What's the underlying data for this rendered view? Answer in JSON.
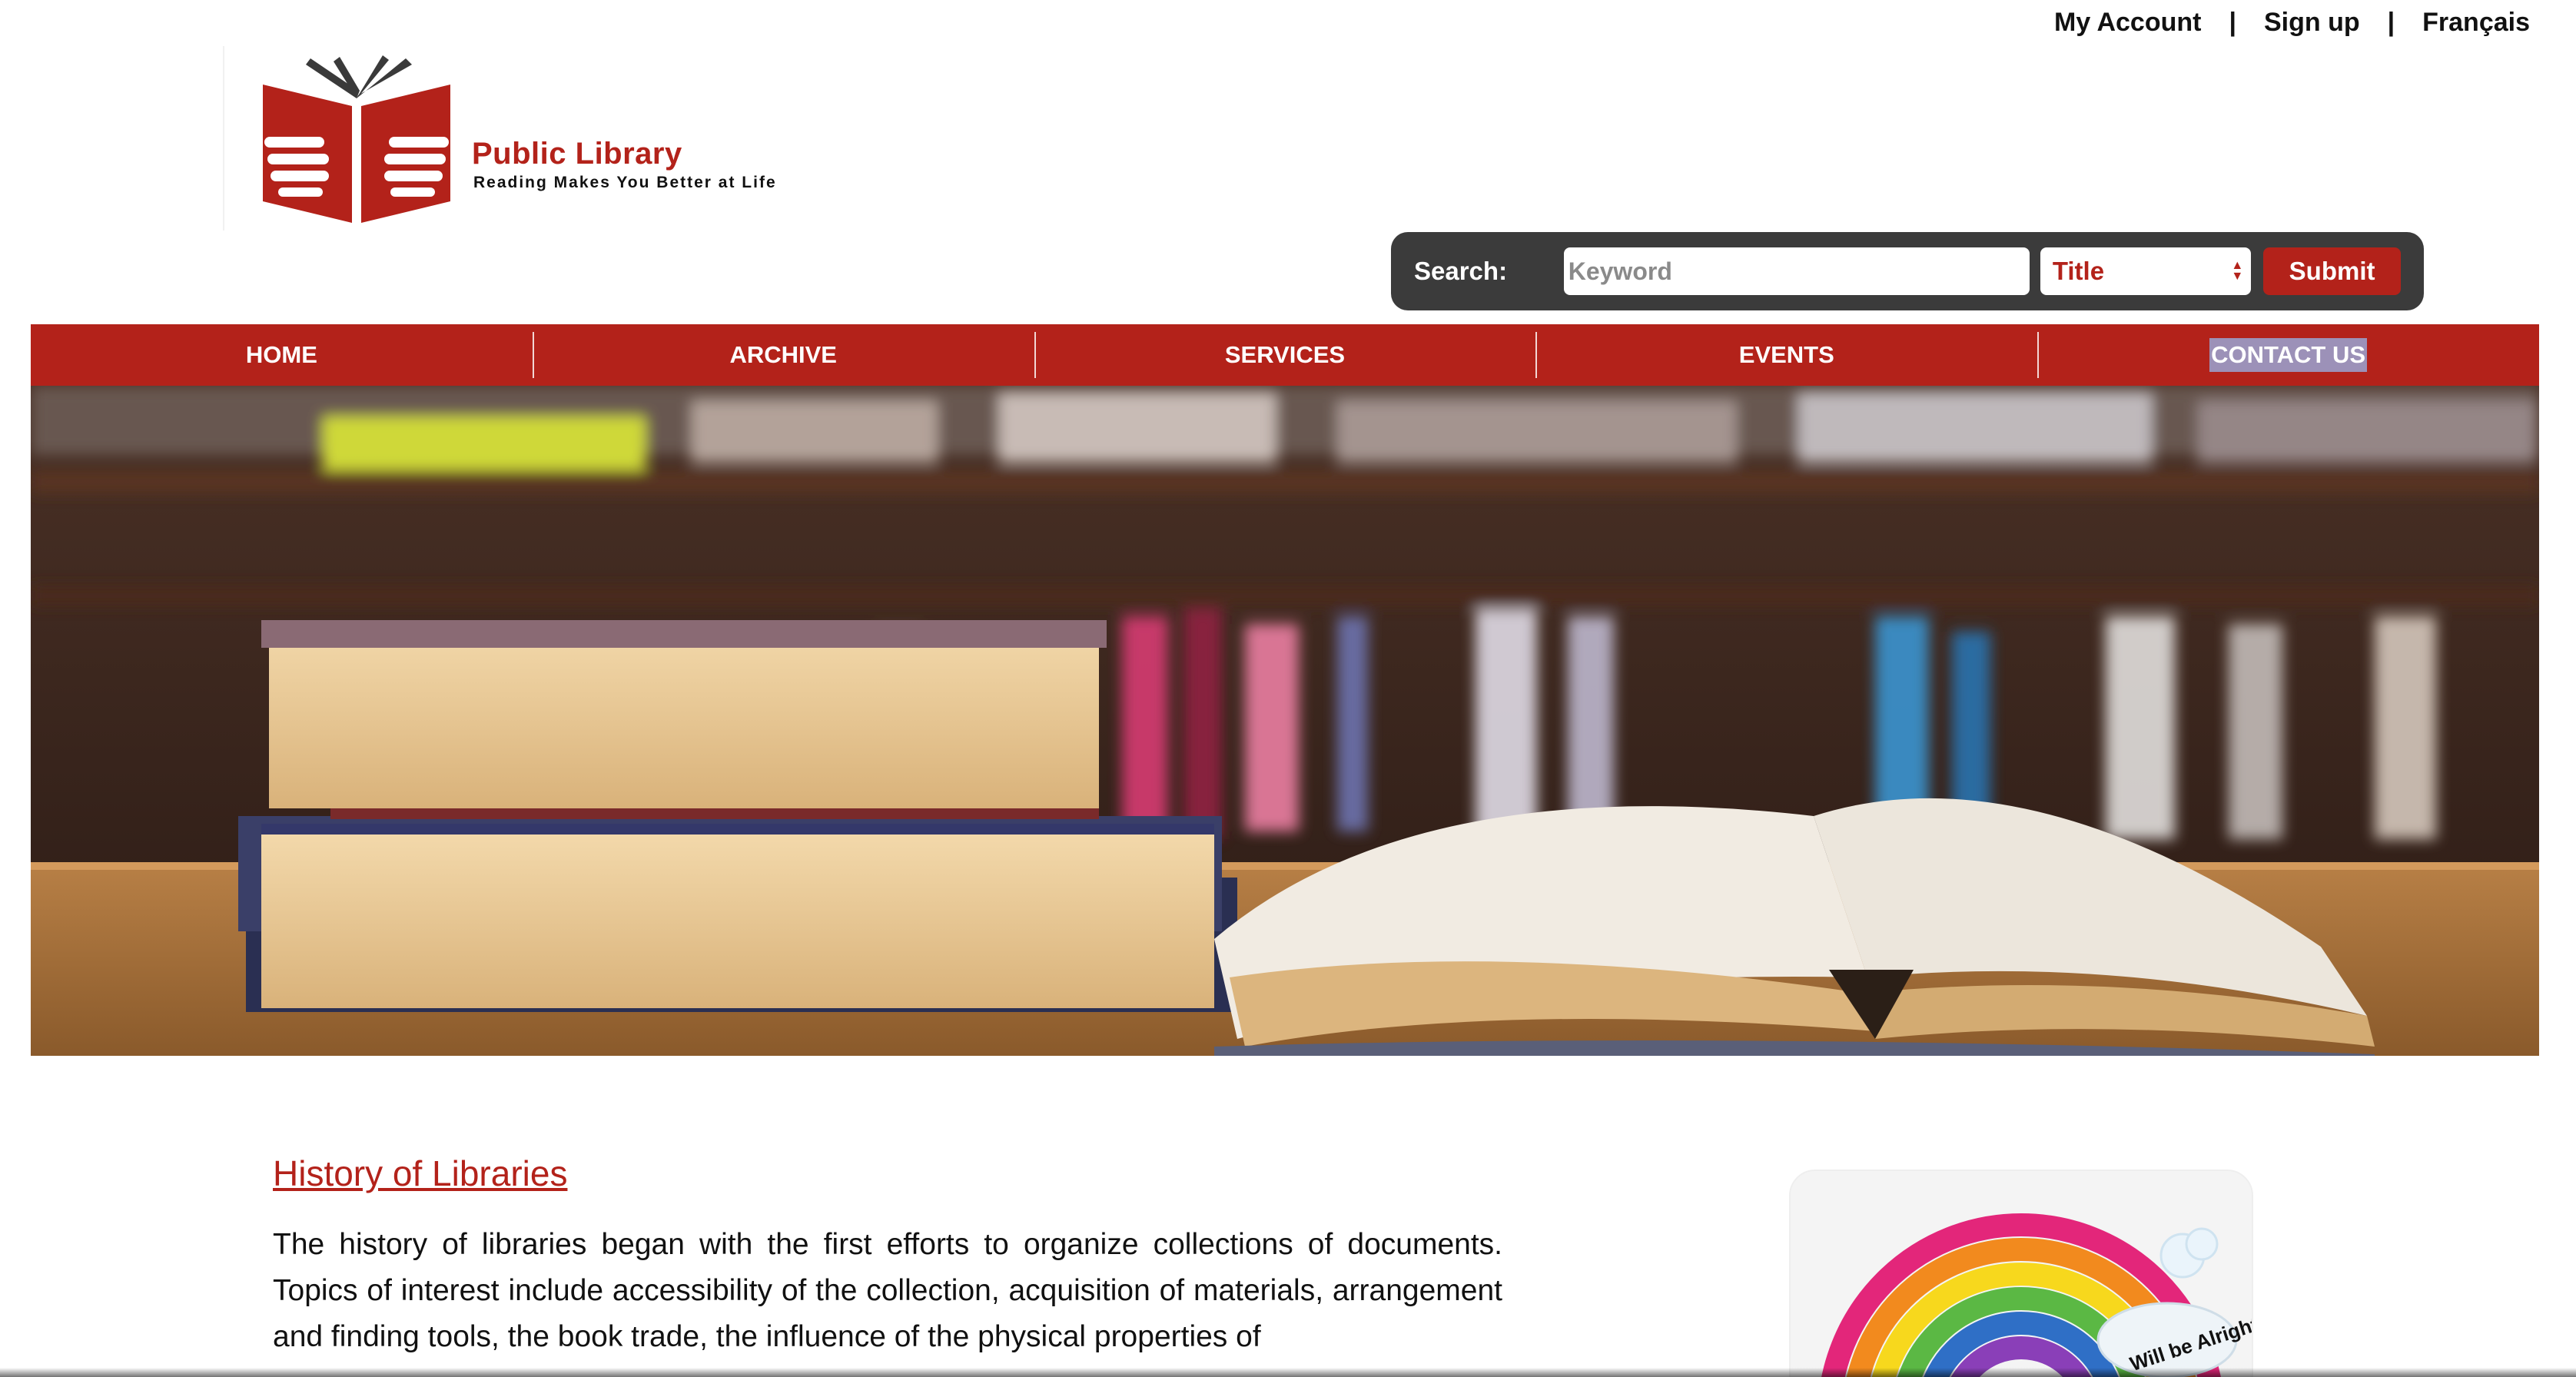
{
  "topbar": {
    "my_account": "My Account",
    "sign_up": "Sign up",
    "language": "Français",
    "separator": "|"
  },
  "logo": {
    "title": "Public Library",
    "tagline": "Reading Makes You Better at Life",
    "icon": "open-book-hands-icon"
  },
  "search": {
    "label": "Search:",
    "placeholder": "Keyword",
    "value": "",
    "field_selected": "Title",
    "submit_label": "Submit"
  },
  "nav": {
    "items": [
      {
        "label": "HOME"
      },
      {
        "label": "ARCHIVE"
      },
      {
        "label": "SERVICES"
      },
      {
        "label": "EVENTS"
      },
      {
        "label": "CONTACT US",
        "highlighted": true
      }
    ]
  },
  "hero": {
    "image": "books-on-table-photo"
  },
  "article": {
    "title": "History of Libraries",
    "body": "The history of libraries began with the first efforts to organize collections of documents. Topics of interest include accessibility of the collection, acquisition of materials, arrangement and finding tools, the book trade, the influence of the physical properties of"
  },
  "promo": {
    "image": "rainbow-illustration",
    "caption": "Will be Alright!"
  },
  "colors": {
    "brand_red": "#b3221a",
    "search_bg": "#3b3b3b",
    "selection_highlight": "#9c91b8"
  }
}
